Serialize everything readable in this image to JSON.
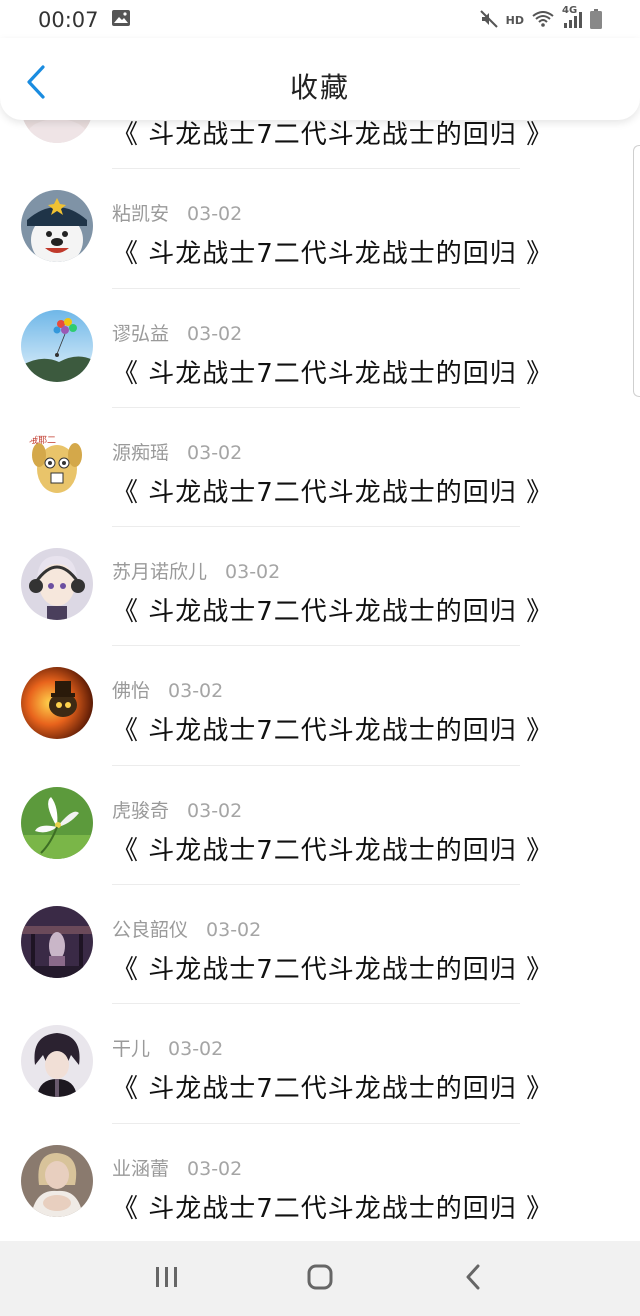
{
  "status_bar": {
    "time": "00:07",
    "network": "HD",
    "signal": "4G"
  },
  "header": {
    "title": "收藏"
  },
  "items": [
    {
      "name": "",
      "date": "",
      "content": "《 斗龙战士7二代斗龙战士的回归 》",
      "avatar": "partial"
    },
    {
      "name": "粘凯安",
      "date": "03-02",
      "content": "《 斗龙战士7二代斗龙战士的回归 》",
      "avatar": "bear"
    },
    {
      "name": "谬弘益",
      "date": "03-02",
      "content": "《 斗龙战士7二代斗龙战士的回归 》",
      "avatar": "balloons"
    },
    {
      "name": "源痴瑶",
      "date": "03-02",
      "content": "《 斗龙战士7二代斗龙战士的回归 》",
      "avatar": "cartoon"
    },
    {
      "name": "苏月诺欣儿",
      "date": "03-02",
      "content": "《 斗龙战士7二代斗龙战士的回归 》",
      "avatar": "anime-girl"
    },
    {
      "name": "佛怡",
      "date": "03-02",
      "content": "《 斗龙战士7二代斗龙战士的回归 》",
      "avatar": "fire"
    },
    {
      "name": "虎骏奇",
      "date": "03-02",
      "content": "《 斗龙战士7二代斗龙战士的回归 》",
      "avatar": "flower"
    },
    {
      "name": "公良韶仪",
      "date": "03-02",
      "content": "《 斗龙战士7二代斗龙战士的回归 》",
      "avatar": "dark-scene"
    },
    {
      "name": "干儿",
      "date": "03-02",
      "content": "《 斗龙战士7二代斗龙战士的回归 》",
      "avatar": "anime-boy"
    },
    {
      "name": "业涵蕾",
      "date": "03-02",
      "content": "《 斗龙战士7二代斗龙战士的回归 》",
      "avatar": "girl-photo"
    }
  ],
  "colors": {
    "accent": "#1a8ce0",
    "nav_bg": "#f1f1f1"
  }
}
